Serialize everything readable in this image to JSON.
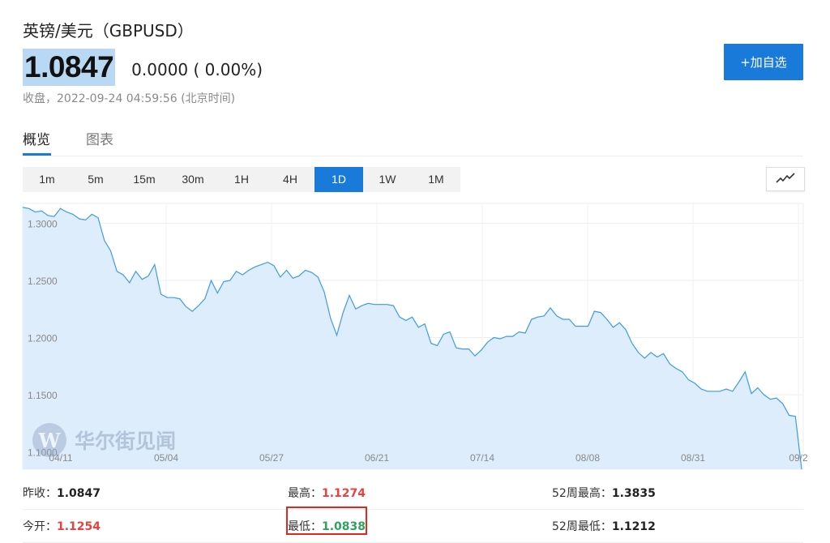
{
  "header": {
    "title": "英镑/美元（GBPUSD）",
    "price": "1.0847",
    "change": "0.0000 ( 0.00%)",
    "status": "收盘，2022-09-24 04:59:56 (北京时间)",
    "add_button": "+加自选"
  },
  "tabs": [
    {
      "label": "概览",
      "active": true
    },
    {
      "label": "图表",
      "active": false
    }
  ],
  "periods": [
    {
      "label": "1m"
    },
    {
      "label": "5m"
    },
    {
      "label": "15m"
    },
    {
      "label": "30m"
    },
    {
      "label": "1H"
    },
    {
      "label": "4H"
    },
    {
      "label": "1D",
      "active": true
    },
    {
      "label": "1W"
    },
    {
      "label": "1M"
    }
  ],
  "chart_type_icon": "line-chart-icon",
  "watermark": "华尔街见闻",
  "chart_data": {
    "type": "area",
    "title": "",
    "xlabel": "",
    "ylabel": "",
    "x_ticks": [
      "04/11",
      "05/04",
      "05/27",
      "06/21",
      "07/14",
      "08/08",
      "08/31",
      "09/2"
    ],
    "y_ticks": [
      "1.3000",
      "1.2500",
      "1.2000",
      "1.1500",
      "1.1000"
    ],
    "ylim": [
      1.0847,
      1.3175
    ],
    "grid": true,
    "series": [
      {
        "values": [
          1.314,
          1.313,
          1.31,
          1.311,
          1.307,
          1.306,
          1.313,
          1.31,
          1.308,
          1.304,
          1.303,
          1.308,
          1.305,
          1.285,
          1.276,
          1.258,
          1.255,
          1.248,
          1.258,
          1.251,
          1.254,
          1.264,
          1.238,
          1.235,
          1.235,
          1.234,
          1.227,
          1.223,
          1.228,
          1.234,
          1.25,
          1.239,
          1.249,
          1.25,
          1.258,
          1.255,
          1.259,
          1.262,
          1.264,
          1.266,
          1.263,
          1.253,
          1.259,
          1.252,
          1.254,
          1.259,
          1.257,
          1.253,
          1.24,
          1.217,
          1.202,
          1.222,
          1.237,
          1.225,
          1.228,
          1.23,
          1.229,
          1.229,
          1.229,
          1.228,
          1.218,
          1.215,
          1.218,
          1.209,
          1.212,
          1.195,
          1.193,
          1.203,
          1.205,
          1.191,
          1.19,
          1.19,
          1.184,
          1.189,
          1.196,
          1.2,
          1.199,
          1.201,
          1.201,
          1.205,
          1.204,
          1.216,
          1.218,
          1.219,
          1.226,
          1.219,
          1.216,
          1.216,
          1.21,
          1.21,
          1.21,
          1.223,
          1.222,
          1.216,
          1.209,
          1.213,
          1.207,
          1.195,
          1.187,
          1.182,
          1.187,
          1.183,
          1.186,
          1.177,
          1.173,
          1.17,
          1.163,
          1.16,
          1.155,
          1.153,
          1.153,
          1.153,
          1.155,
          1.153,
          1.161,
          1.17,
          1.151,
          1.156,
          1.15,
          1.146,
          1.147,
          1.142,
          1.132,
          1.131,
          1.0847
        ],
        "color": "#3d9be9"
      }
    ]
  },
  "stats": {
    "row1": [
      {
        "label": "昨收：",
        "value": "1.0847",
        "tone": "normal"
      },
      {
        "label": "最高：",
        "value": "1.1274",
        "tone": "up"
      },
      {
        "label": "52周最高：",
        "value": "1.3835",
        "tone": "normal"
      }
    ],
    "row2": [
      {
        "label": "今开：",
        "value": "1.1254",
        "tone": "up"
      },
      {
        "label": "最低：",
        "value": "1.0838",
        "tone": "down"
      },
      {
        "label": "52周最低：",
        "value": "1.1212",
        "tone": "normal"
      }
    ]
  },
  "colors": {
    "accent": "#1a7ad9",
    "up": "#e8413f",
    "down": "#2fa35a",
    "chart_line": "#3d9be9",
    "chart_fill": "#deedfb",
    "highlight_box": "#e4261f"
  }
}
